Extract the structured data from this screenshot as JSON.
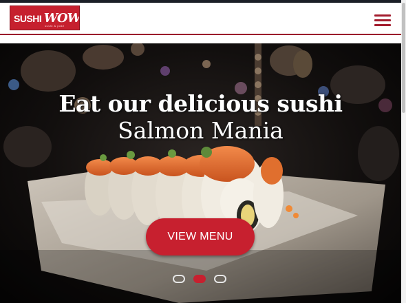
{
  "brand": {
    "logo_main": "SUSHI",
    "logo_accent": "WOW",
    "logo_tagline": "sushi & poke",
    "primary_color": "#c7202f",
    "rule_color": "#9b1b2b"
  },
  "header": {
    "menu_icon": "hamburger-menu-icon"
  },
  "hero": {
    "title": "Eat our delicious sushi",
    "subtitle": "Salmon Mania",
    "cta_label": "VIEW MENU",
    "slide_count": 3,
    "active_slide": 2
  }
}
